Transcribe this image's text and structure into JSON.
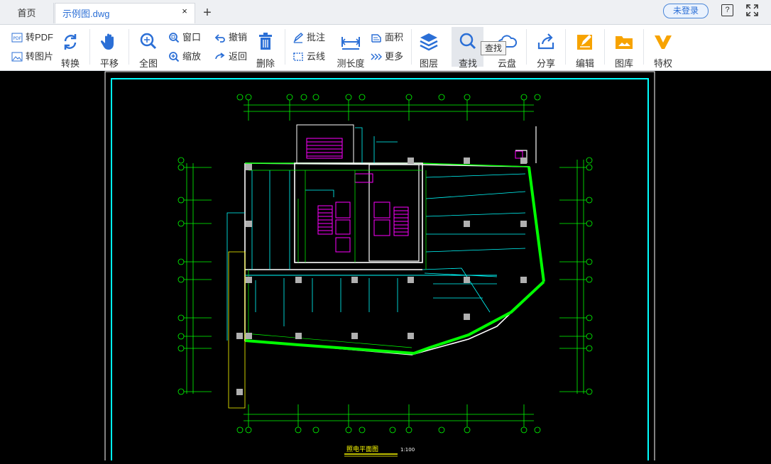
{
  "tabs": {
    "home_label": "首页",
    "file_label": "示例图.dwg",
    "close_glyph": "×",
    "add_glyph": "+"
  },
  "header": {
    "login_label": "未登录",
    "help_glyph": "?"
  },
  "toolbar": {
    "to_pdf": "转PDF",
    "to_image": "转图片",
    "convert": "转换",
    "pan": "平移",
    "fit_all": "全图",
    "window_zoom": "窗口",
    "zoom": "缩放",
    "undo": "撤销",
    "back": "返回",
    "delete": "删除",
    "annotate": "批注",
    "cloud_line": "云线",
    "measure_length": "测长度",
    "area": "面积",
    "more": "更多",
    "layers": "图层",
    "find": "查找",
    "cloud_disk": "云盘",
    "share": "分享",
    "edit": "编辑",
    "gallery": "图库",
    "privilege": "特权",
    "find_tooltip": "查找"
  },
  "drawing": {
    "title": "照电平面图",
    "scale": "1:100"
  },
  "colors": {
    "accent": "#2b6fd6",
    "cad_cyan": "#00ffff",
    "cad_green": "#00ff00",
    "cad_magenta": "#ff00ff",
    "cad_yellow": "#ffff00"
  }
}
